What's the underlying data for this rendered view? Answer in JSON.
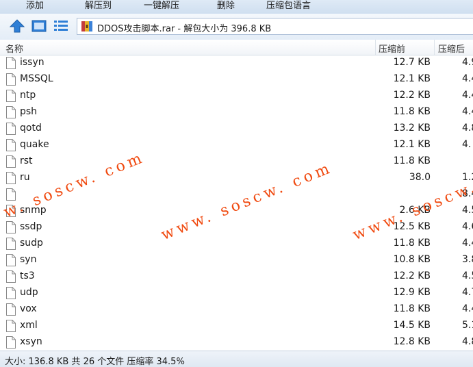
{
  "toolbar": {
    "add": "添加",
    "extract_to": "解压到",
    "one_click_extract": "一键解压",
    "delete": "删除",
    "language_pack": "压缩包语言"
  },
  "address": {
    "path": "DDOS攻击脚本.rar - 解包大小为 396.8 KB"
  },
  "columns": {
    "name": "名称",
    "original_size": "压缩前",
    "packed_size": "压缩后"
  },
  "files": [
    {
      "name": "issyn",
      "size": "12.7 KB",
      "packed": "4.9"
    },
    {
      "name": "MSSQL",
      "size": "12.1 KB",
      "packed": "4.4"
    },
    {
      "name": "ntp",
      "size": "12.2 KB",
      "packed": "4.4"
    },
    {
      "name": "psh",
      "size": "11.8 KB",
      "packed": "4.4"
    },
    {
      "name": "qotd",
      "size": "13.2 KB",
      "packed": "4.8"
    },
    {
      "name": "quake",
      "size": "12.1 KB",
      "packed": "4."
    },
    {
      "name": "rst",
      "size": "11.8 KB",
      "packed": ""
    },
    {
      "name": "ru",
      "size": "38.0",
      "packed": "1.2"
    },
    {
      "name": "",
      "size": "",
      "packed": "8.4"
    },
    {
      "name": "snmp",
      "size": "2.6 KB",
      "packed": "4.5"
    },
    {
      "name": "ssdp",
      "size": "12.5 KB",
      "packed": "4.6"
    },
    {
      "name": "sudp",
      "size": "11.8 KB",
      "packed": "4.4"
    },
    {
      "name": "syn",
      "size": "10.8 KB",
      "packed": "3.8"
    },
    {
      "name": "ts3",
      "size": "12.2 KB",
      "packed": "4.5"
    },
    {
      "name": "udp",
      "size": "12.9 KB",
      "packed": "4.7"
    },
    {
      "name": "vox",
      "size": "11.8 KB",
      "packed": "4.4"
    },
    {
      "name": "xml",
      "size": "14.5 KB",
      "packed": "5.1"
    },
    {
      "name": "xsyn",
      "size": "12.8 KB",
      "packed": "4.8"
    }
  ],
  "watermark": {
    "text_1": "w. soscw. com",
    "text_2": "www. soscw. com",
    "text_3": "www. soscw. c"
  },
  "status": {
    "text": "大小: 136.8 KB 共 26 个文件 压缩率 34.5%"
  },
  "colors": {
    "watermark": "#f04a10",
    "toolbar_bg": "#d8e6f4"
  }
}
